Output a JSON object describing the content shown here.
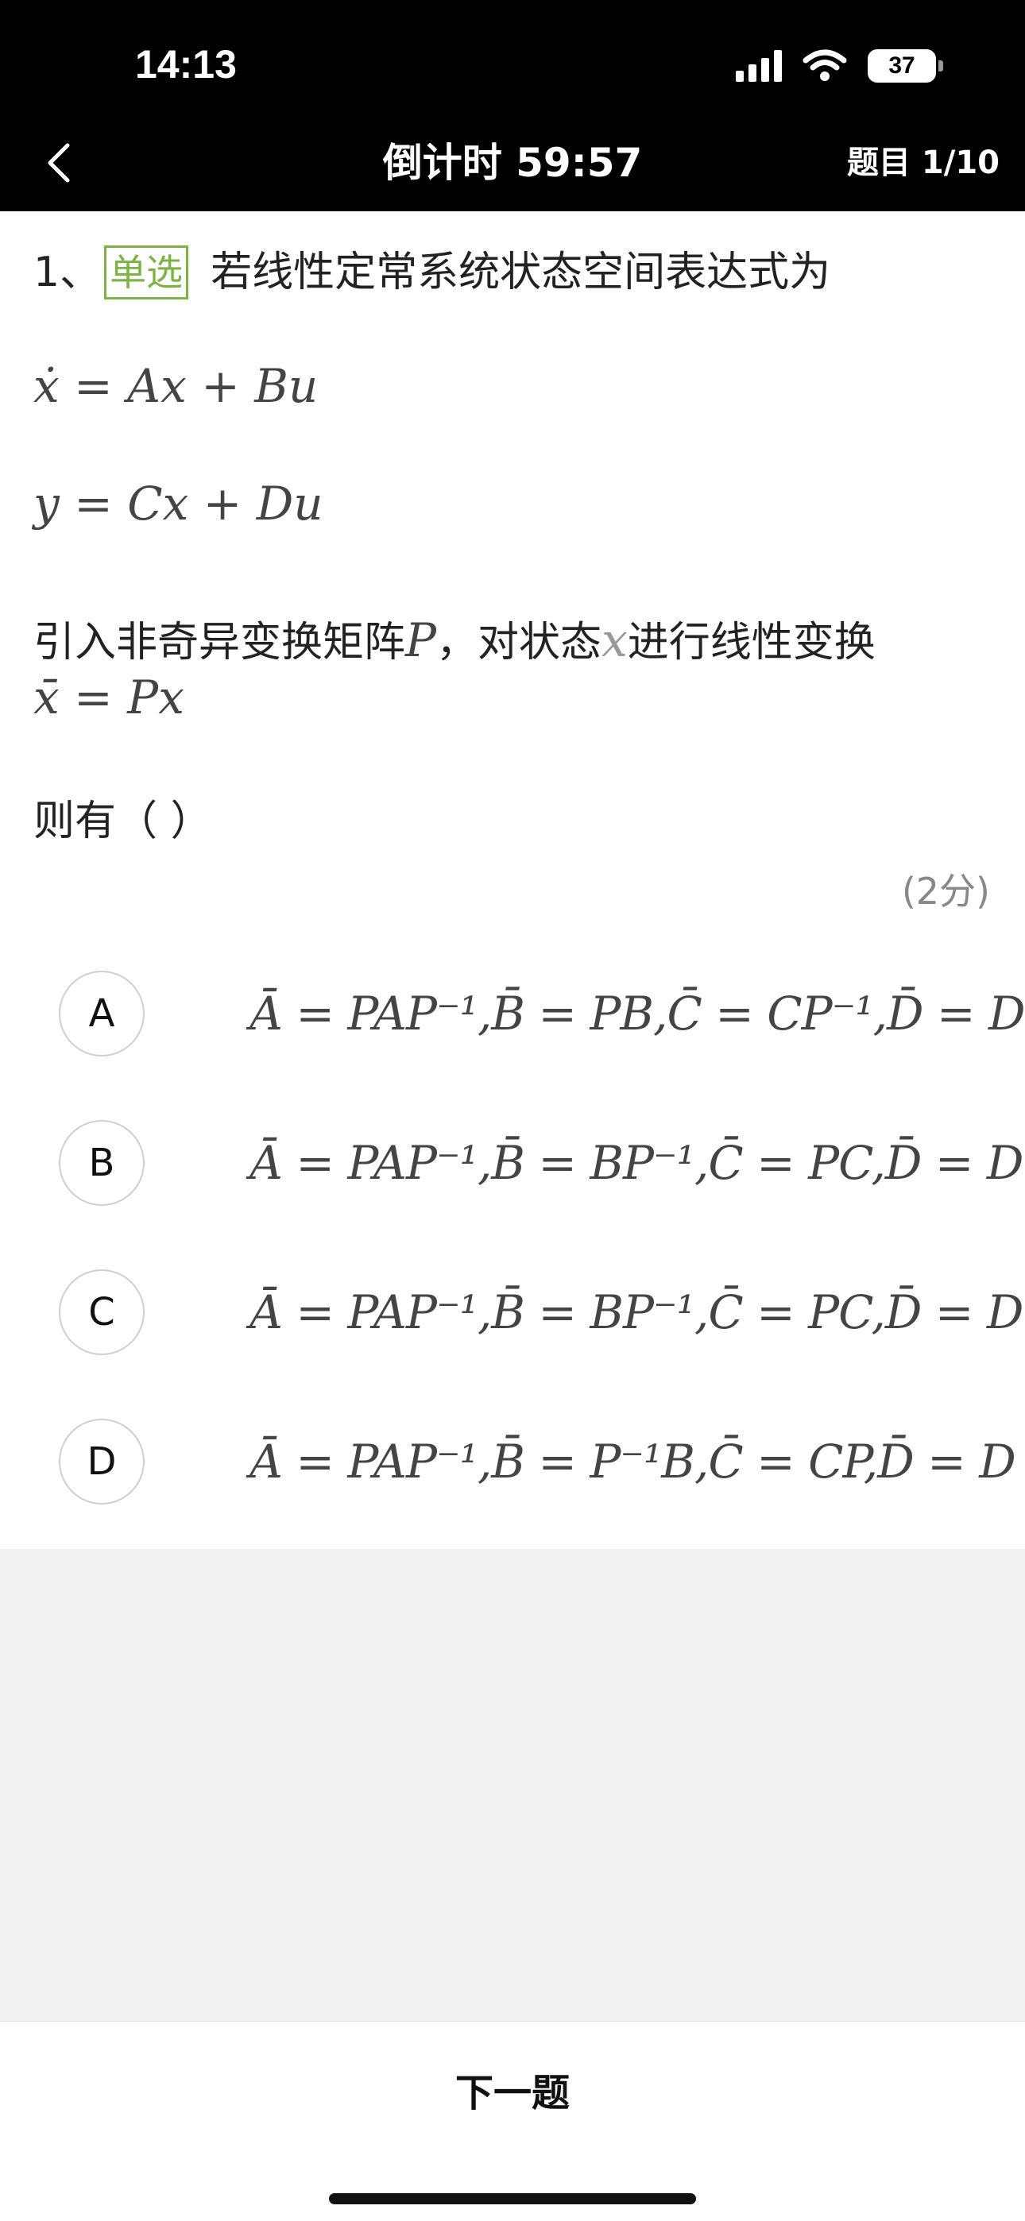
{
  "status_bar": {
    "time": "14:13",
    "battery": "37"
  },
  "nav": {
    "title": "倒计时 59:57",
    "progress": "题目 1/10"
  },
  "question": {
    "number": "1、",
    "type": "单选",
    "stem": "若线性定常系统状态空间表达式为",
    "eq1": "ẋ = Ax + Bu",
    "eq2": "y = Cx + Du",
    "line3": "引入非奇异变换矩阵",
    "var_p": "P",
    "line3b": "，对状态",
    "var_x": "x",
    "line3c": "进行线性变换",
    "eq3": "x̄ = Px",
    "ask": "则有（   ）",
    "score": "(2分)"
  },
  "options": [
    {
      "letter": "A",
      "text": "Ā = PAP⁻¹,B̄ = PB,C̄ = CP⁻¹,D̄ = D"
    },
    {
      "letter": "B",
      "text": "Ā = PAP⁻¹,B̄ = BP⁻¹,C̄ = PC,D̄ = D"
    },
    {
      "letter": "C",
      "text": "Ā = PAP⁻¹,B̄ = BP⁻¹,C̄ = PC,D̄ = D"
    },
    {
      "letter": "D",
      "text": "Ā = PAP⁻¹,B̄ = P⁻¹B,C̄ = CP,D̄ = D"
    }
  ],
  "footer": {
    "next_label": "下一题"
  },
  "icons": {
    "back": "chevron-left-icon",
    "signal": "signal-icon",
    "wifi": "wifi-icon",
    "battery": "battery-icon"
  },
  "colors": {
    "accent": "#7cb342",
    "bar": "#000000"
  }
}
